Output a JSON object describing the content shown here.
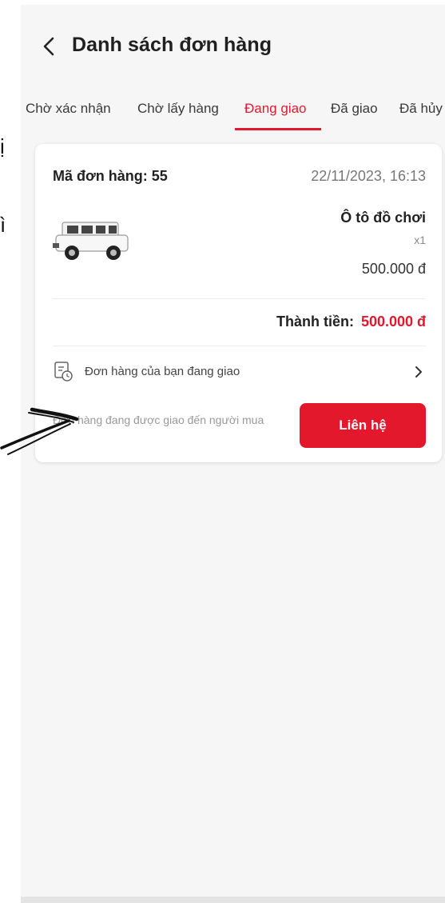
{
  "header": {
    "title": "Danh sách đơn hàng"
  },
  "tabs": [
    {
      "label": "Chờ xác nhận"
    },
    {
      "label": "Chờ lấy hàng"
    },
    {
      "label": "Đang giao"
    },
    {
      "label": "Đã giao"
    },
    {
      "label": "Đã hủy"
    }
  ],
  "active_tab": "Đang giao",
  "order": {
    "id_label": "Mã đơn hàng: 55",
    "date": "22/11/2023, 16:13",
    "product": {
      "name": "Ô tô đồ chơi",
      "quantity": "x1",
      "price": "500.000 đ"
    },
    "total_label": "Thành tiền:",
    "total_value": "500.000 đ",
    "status_text": "Đơn hàng của bạn đang giao",
    "note": "Đơn hàng đang được giao đến người mua",
    "contact_label": "Liên hệ"
  },
  "side_glyphs": [
    "ị",
    "ì"
  ],
  "colors": {
    "accent": "#e3182d",
    "background": "#f6f6f6"
  },
  "icons": [
    "chevron-left-icon",
    "toy-car-image",
    "delivery-status-icon",
    "chevron-right-icon",
    "hand-drawn-arrow"
  ]
}
